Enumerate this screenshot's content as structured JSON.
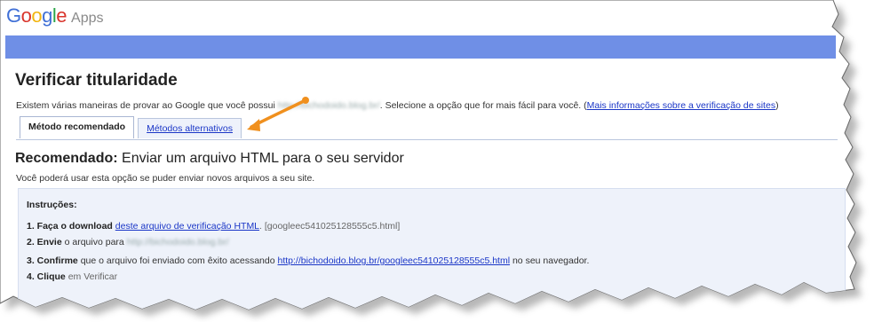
{
  "header": {
    "logo_text": "Google",
    "logo_apps": "Apps"
  },
  "page": {
    "title": "Verificar titularidade",
    "intro_before": "Existem várias maneiras de provar ao Google que você possui",
    "intro_blurred_domain": "http://bichodoido.blog.br/",
    "intro_after": ". Selecione a opção que for mais fácil para você. (",
    "intro_link": "Mais informações sobre a verificação de sites",
    "intro_close": ")"
  },
  "tabs": [
    {
      "label": "Método recomendado",
      "active": true
    },
    {
      "label": "Métodos alternativos",
      "active": false
    }
  ],
  "recommended": {
    "heading_bold": "Recomendado:",
    "heading_rest": "Enviar um arquivo HTML para o seu servidor",
    "subtitle": "Você poderá usar esta opção se puder enviar novos arquivos a seu site."
  },
  "instructions": {
    "title": "Instruções:",
    "step1_bold": "1. Faça o download",
    "step1_link": "deste arquivo de verificação HTML",
    "step1_file": ". [googleec541025128555c5.html]",
    "step2_bold": "2. Envie",
    "step2_text": "o arquivo para",
    "step2_blurred": "http://bichodoido.blog.br/",
    "step3_bold": "3. Confirme",
    "step3_text": "que o arquivo foi enviado com êxito acessando",
    "step3_link": "http://bichodoido.blog.br/googleec541025128555c5.html",
    "step3_after": "no seu navegador.",
    "step4_partial": "4. Clique",
    "step4_partial_rest": "em Verificar"
  },
  "annotation": {
    "arrow_color": "#f0901e"
  }
}
